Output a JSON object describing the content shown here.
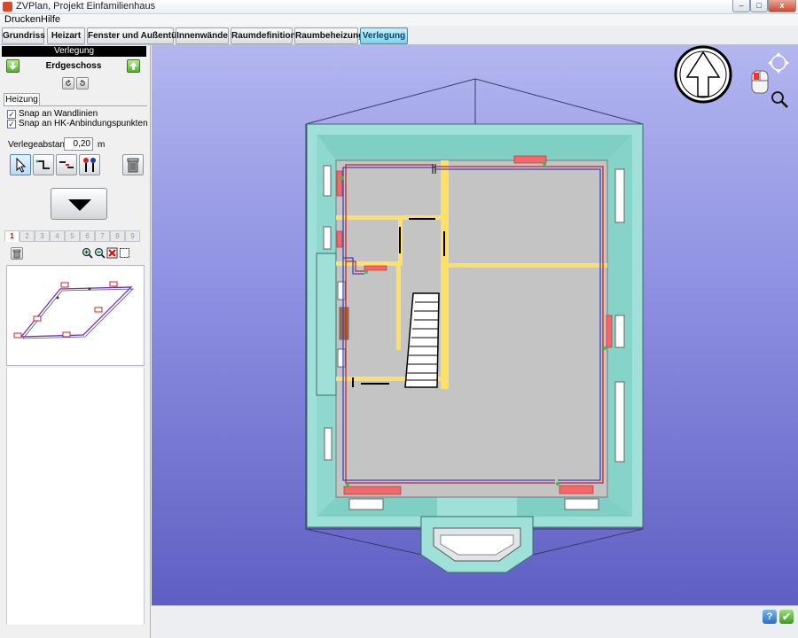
{
  "window": {
    "title": "ZVPlan, Projekt Einfamilienhaus",
    "minimize_glyph": "–",
    "maximize_glyph": "□",
    "close_glyph": "x"
  },
  "menu": {
    "items": [
      "Drucken",
      "Hilfe"
    ]
  },
  "toolbar": {
    "tabs": [
      {
        "label": "Grundriss",
        "active": false
      },
      {
        "label": "Heizart",
        "active": false
      },
      {
        "label": "Fenster und Außentüren",
        "active": false
      },
      {
        "label": "Innenwände",
        "active": false
      },
      {
        "label": "Raumdefinition",
        "active": false
      },
      {
        "label": "Raumbeheizung",
        "active": false
      },
      {
        "label": "Verlegung",
        "active": true
      }
    ]
  },
  "panel": {
    "header": "Verlegung",
    "floor_name": "Erdgeschoss",
    "sub_tab": "Heizung",
    "snap_wall": {
      "label": "Snap an Wandlinien",
      "checked": true
    },
    "snap_hk": {
      "label": "Snap an HK-Anbindungspunkten",
      "checked": true
    },
    "spacing_label": "Verlegeabstand",
    "spacing_value": "0,20",
    "spacing_unit": "m",
    "layer_tabs": [
      "1",
      "2",
      "3",
      "4",
      "5",
      "6",
      "7",
      "8",
      "9"
    ],
    "active_layer": "1",
    "icons": {
      "floor_down": "arrow-down-icon",
      "floor_up": "arrow-up-icon",
      "undo": "undo-icon",
      "redo": "redo-icon",
      "select": "cursor-icon",
      "pipe": "pipe-route-icon",
      "connect": "connector-icon",
      "riser": "riser-icon",
      "delete": "trash-icon",
      "apply": "triangle-down-icon",
      "clear": "trash-icon",
      "zoom_in": "zoom-in-icon",
      "zoom_out": "zoom-out-icon",
      "zoom_delete": "delete-icon",
      "zoom_fit": "fit-icon"
    }
  },
  "viewport": {
    "colors": {
      "wall": "#9fe0d8",
      "wall_dark": "#6fbfb6",
      "floor": "#c4c4c4",
      "beam": "#ffe066",
      "radiator": "#f06a6a",
      "pipe_red": "#cc2222",
      "pipe_blue": "#3344cc"
    },
    "nav_icons": [
      "north-arrow-icon",
      "mouse-icon",
      "pan-icon",
      "zoom-icon"
    ]
  },
  "status": {
    "help_label": "?",
    "ok_label": "✔"
  }
}
